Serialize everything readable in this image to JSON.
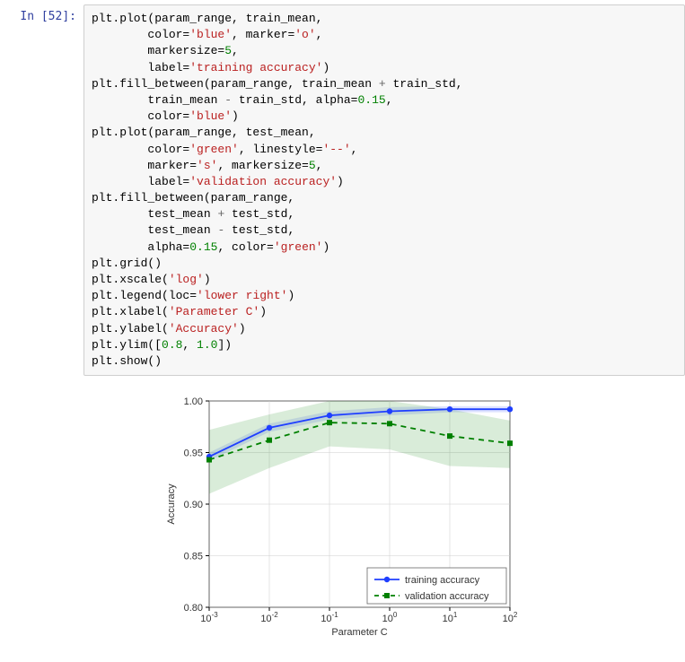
{
  "cell": {
    "prompt": "In [52]:",
    "code_lines": [
      [
        "plt.plot(param_range, train_mean,"
      ],
      [
        "        color=",
        "'blue'",
        ", marker=",
        "'o'",
        ","
      ],
      [
        "        markersize=",
        "5",
        ","
      ],
      [
        "        label=",
        "'training accuracy'",
        ")"
      ],
      [
        "plt.fill_between(param_range, train_mean ",
        "+",
        " train_std,"
      ],
      [
        "        train_mean ",
        "-",
        " train_std, alpha=",
        "0.15",
        ","
      ],
      [
        "        color=",
        "'blue'",
        ")"
      ],
      [
        "plt.plot(param_range, test_mean,"
      ],
      [
        "        color=",
        "'green'",
        ", linestyle=",
        "'--'",
        ","
      ],
      [
        "        marker=",
        "'s'",
        ", markersize=",
        "5",
        ","
      ],
      [
        "        label=",
        "'validation accuracy'",
        ")"
      ],
      [
        "plt.fill_between(param_range,"
      ],
      [
        "        test_mean ",
        "+",
        " test_std,"
      ],
      [
        "        test_mean ",
        "-",
        " test_std,"
      ],
      [
        "        alpha=",
        "0.15",
        ", color=",
        "'green'",
        ")"
      ],
      [
        "plt.grid()"
      ],
      [
        "plt.xscale(",
        "'log'",
        ")"
      ],
      [
        "plt.legend(loc=",
        "'lower right'",
        ")"
      ],
      [
        "plt.xlabel(",
        "'Parameter C'",
        ")"
      ],
      [
        "plt.ylabel(",
        "'Accuracy'",
        ")"
      ],
      [
        "plt.ylim([",
        "0.8",
        ", ",
        "1.0",
        "])"
      ],
      [
        "plt.show()"
      ]
    ]
  },
  "chart_data": {
    "type": "line",
    "xlabel": "Parameter C",
    "ylabel": "Accuracy",
    "xscale": "log",
    "ylim": [
      0.8,
      1.0
    ],
    "x": [
      0.001,
      0.01,
      0.1,
      1,
      10,
      100
    ],
    "x_ticklabels": [
      "10⁻³",
      "10⁻²",
      "10⁻¹",
      "10⁰",
      "10¹",
      "10²"
    ],
    "y_ticks": [
      0.8,
      0.85,
      0.9,
      0.95,
      1.0
    ],
    "y_ticklabels": [
      "0.80",
      "0.85",
      "0.90",
      "0.95",
      "1.00"
    ],
    "series": [
      {
        "name": "training accuracy",
        "color": "#1f3fff",
        "marker": "o",
        "linestyle": "-",
        "values": [
          0.946,
          0.974,
          0.986,
          0.99,
          0.992,
          0.992
        ],
        "fill_low": [
          0.942,
          0.97,
          0.982,
          0.986,
          0.989,
          0.989
        ],
        "fill_high": [
          0.95,
          0.978,
          0.99,
          0.994,
          0.995,
          0.995
        ]
      },
      {
        "name": "validation accuracy",
        "color": "#008000",
        "marker": "s",
        "linestyle": "--",
        "values": [
          0.943,
          0.962,
          0.979,
          0.978,
          0.966,
          0.959
        ],
        "fill_low": [
          0.91,
          0.935,
          0.956,
          0.953,
          0.937,
          0.935
        ],
        "fill_high": [
          0.972,
          0.987,
          1.0,
          1.0,
          0.992,
          0.981
        ]
      }
    ],
    "legend": {
      "loc": "lower right",
      "items": [
        "training accuracy",
        "validation accuracy"
      ]
    }
  }
}
